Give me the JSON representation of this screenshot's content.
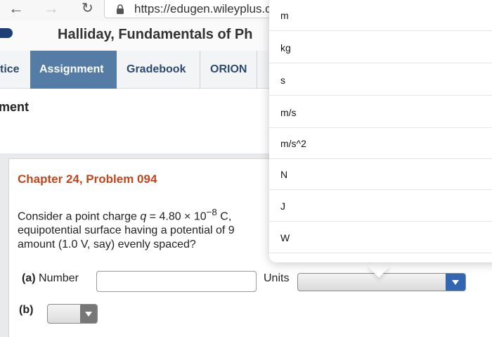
{
  "browser": {
    "url": "https://edugen.wileyplus.c"
  },
  "course": {
    "title": "Halliday, Fundamentals of Ph"
  },
  "tabs": [
    {
      "label": "tice"
    },
    {
      "label": "Assignment"
    },
    {
      "label": "Gradebook"
    },
    {
      "label": "ORION"
    }
  ],
  "section": {
    "heading": "ment"
  },
  "problem": {
    "title": "Chapter 24, Problem 094",
    "line1_prefix": "Consider a point charge ",
    "line1_var": "q",
    "line1_value": " = 4.80 × 10",
    "line1_exp": "−8",
    "line1_suffix": " C,",
    "line2": "equipotential surface having a potential of 9",
    "line3": "amount (1.0 V, say) evenly spaced?"
  },
  "part_a": {
    "label_bold": "(a)",
    "label_text": " Number",
    "number_value": "",
    "units_label": "Units",
    "units_selected": ""
  },
  "part_b": {
    "label": "(b)",
    "selected": ""
  },
  "units_dropdown": {
    "options": [
      "m",
      "kg",
      "s",
      "m/s",
      "m/s^2",
      "N",
      "J",
      "W"
    ]
  },
  "colors": {
    "tab_active_bg": "#557ca5",
    "tab_text": "#2d4a72",
    "problem_title": "#c1461b",
    "select_arrow": "#3266b0"
  }
}
